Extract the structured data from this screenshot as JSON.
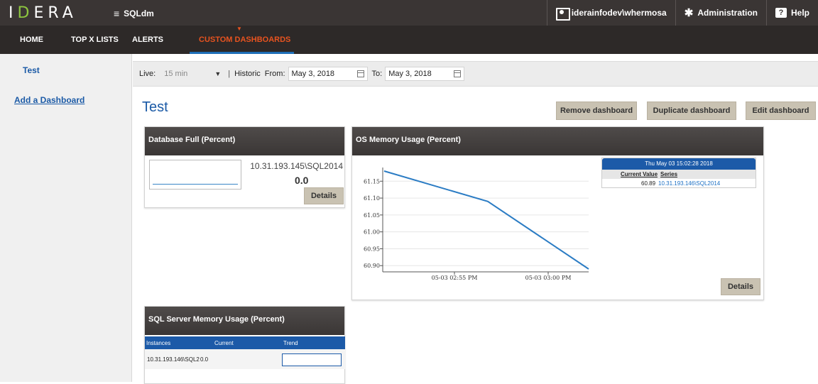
{
  "header": {
    "logo_text": "IDERA",
    "app_name": "SQLdm",
    "user": "iderainfodev\\whermosa",
    "admin_label": "Administration",
    "help_label": "Help"
  },
  "nav": {
    "items": [
      "HOME",
      "TOP X LISTS",
      "ALERTS",
      "CUSTOM DASHBOARDS"
    ],
    "active": "CUSTOM DASHBOARDS"
  },
  "sidebar": {
    "items": [
      {
        "label": "Test"
      },
      {
        "label": "Add a Dashboard"
      }
    ]
  },
  "filter": {
    "live_label": "Live:",
    "live_value": "15 min",
    "historic_label": "Historic",
    "from_label": "From:",
    "from_value": "May 3, 2018",
    "to_label": "To:",
    "to_value": "May 3, 2018",
    "separator": "|"
  },
  "dashboard": {
    "title": "Test",
    "buttons": {
      "remove": "Remove dashboard",
      "duplicate": "Duplicate dashboard",
      "edit": "Edit dashboard"
    }
  },
  "widgets": {
    "database_full": {
      "title": "Database Full (Percent)",
      "instance": "10.31.193.145\\SQL2014",
      "value": "0.0",
      "details": "Details"
    },
    "os_memory": {
      "title": "OS Memory Usage (Percent)",
      "details": "Details",
      "tooltip": {
        "time": "Thu May 03 15:02:28 2018",
        "col_value": "Current Value",
        "col_series": "Series",
        "value": "60.89",
        "series": "10.31.193.146\\SQL2014"
      }
    },
    "sql_memory": {
      "title": "SQL Server Memory Usage (Percent)",
      "columns": [
        "Instances",
        "Current",
        "Trend"
      ],
      "rows": [
        {
          "instance": "10.31.193.146\\SQL2",
          "current": "0.0"
        }
      ]
    }
  },
  "chart_data": {
    "type": "line",
    "title": "OS Memory Usage (Percent)",
    "xlabel": "",
    "ylabel": "",
    "x_ticks": [
      "05-03 02:55 PM",
      "05-03 03:00 PM"
    ],
    "y_ticks": [
      "61.15",
      "61.10",
      "61.05",
      "61.00",
      "60.95",
      "60.90"
    ],
    "ylim": [
      60.89,
      61.18
    ],
    "series": [
      {
        "x": [
          "05-03 02:50 PM",
          "05-03 02:57 PM",
          "05-03 03:02 PM"
        ],
        "values": [
          61.18,
          61.09,
          60.89
        ]
      }
    ],
    "grid": true,
    "line_color": "#2b7cc4"
  }
}
